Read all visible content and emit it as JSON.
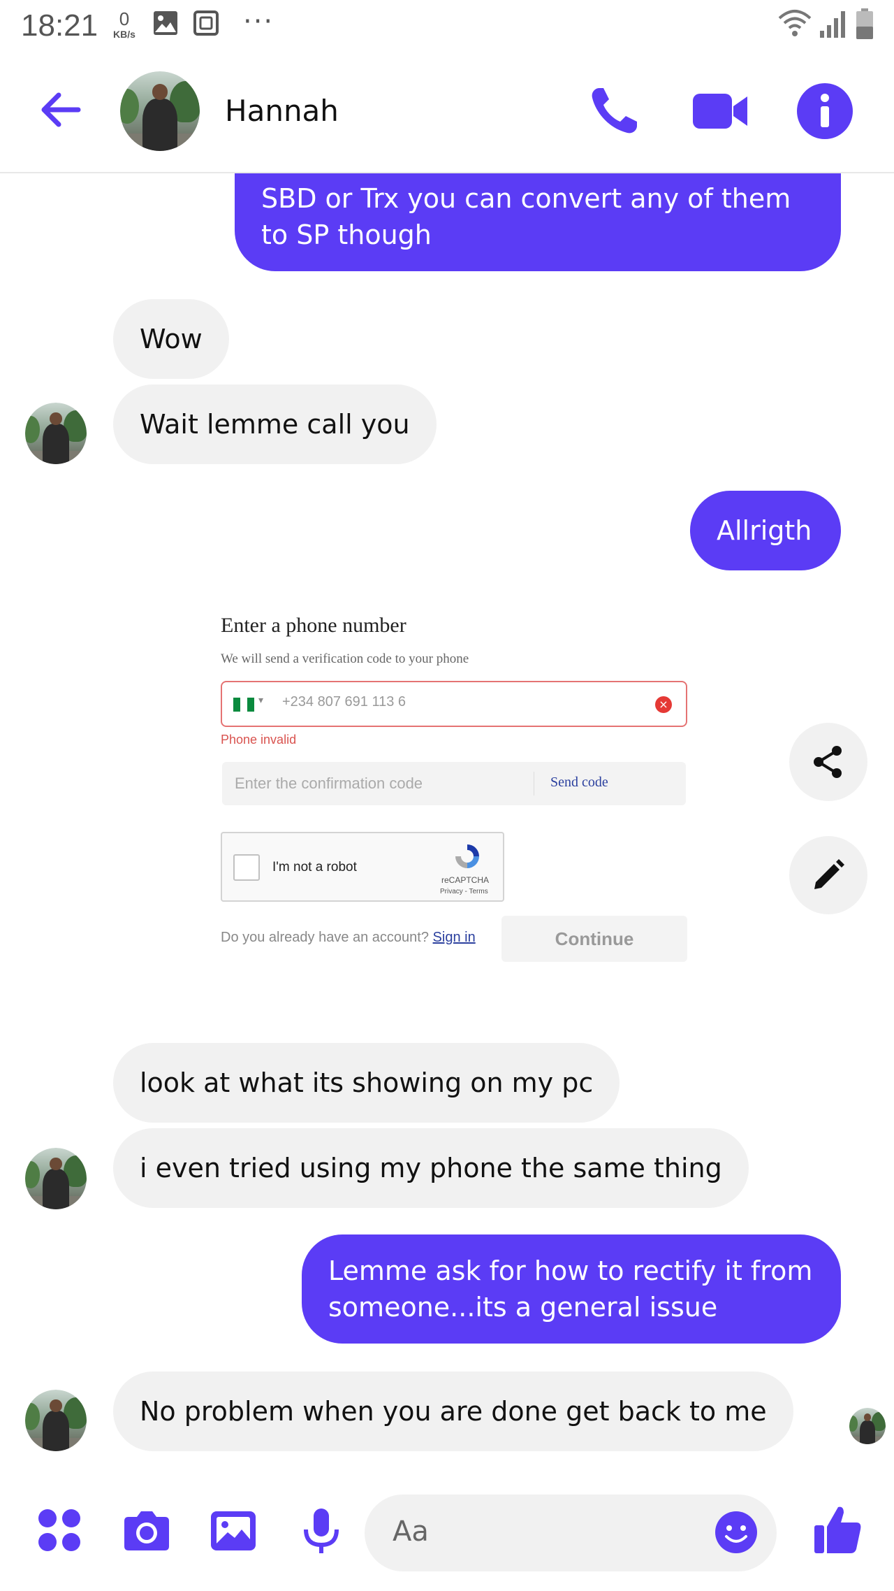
{
  "status_bar": {
    "time": "18:21",
    "net_speed": "0",
    "net_unit": "KB/s",
    "overflow": "···"
  },
  "header": {
    "contact_name": "Hannah"
  },
  "messages": [
    {
      "dir": "out",
      "text": "SBD or Trx you can convert any of them to SP though"
    },
    {
      "dir": "in",
      "text": "Wow"
    },
    {
      "dir": "in",
      "text": "Wait lemme call you"
    },
    {
      "dir": "out",
      "text": "Allrigth"
    },
    {
      "dir": "in",
      "text": "look at what its showing on my pc"
    },
    {
      "dir": "in",
      "text": "i even tried using my phone the same thing"
    },
    {
      "dir": "out",
      "text": "Lemme ask for how to rectify it from someone...its a general issue"
    },
    {
      "dir": "in",
      "text": "No problem when you are done get back to me"
    }
  ],
  "shared_image": {
    "title": "Enter a phone number",
    "subtitle": "We will send a verification code to your phone",
    "phone_value": "+234 807 691 113 6",
    "error": "Phone invalid",
    "code_placeholder": "Enter the confirmation code",
    "send_code": "Send code",
    "captcha_label": "I'm not a robot",
    "captcha_brand": "reCAPTCHA",
    "captcha_links": "Privacy - Terms",
    "account_prompt": "Do you already have an account?",
    "sign_in": "Sign in",
    "continue": "Continue"
  },
  "composer": {
    "placeholder": "Aa"
  },
  "colors": {
    "accent": "#5b3cf5",
    "incoming_bubble": "#f1f1f1",
    "error": "#d9534f"
  },
  "icons": [
    "back-arrow-icon",
    "phone-icon",
    "video-icon",
    "info-icon",
    "share-icon",
    "pencil-icon",
    "menu-dots-icon",
    "camera-icon",
    "gallery-icon",
    "microphone-icon",
    "emoji-icon",
    "thumbs-up-icon"
  ]
}
